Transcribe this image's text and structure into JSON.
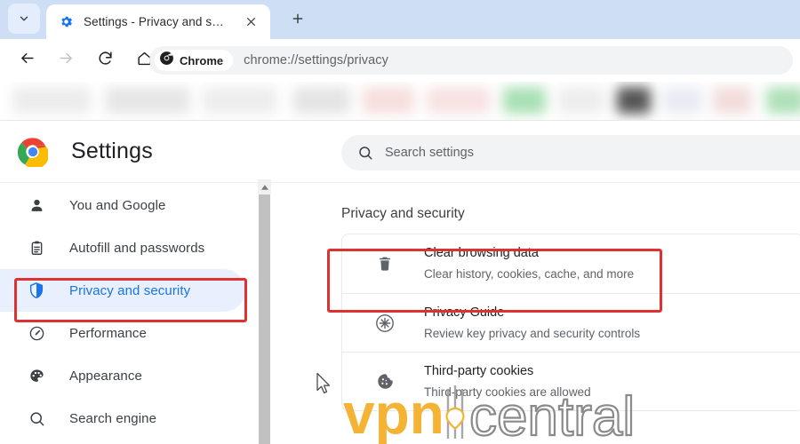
{
  "window": {
    "tab": {
      "title": "Settings - Privacy and security",
      "favicon_icon": "gear-icon",
      "close_icon": "close-icon"
    },
    "tab_search_icon": "chevron-down-icon",
    "new_tab_icon": "plus-icon",
    "toolbar": {
      "back_icon": "arrow-left-icon",
      "forward_icon": "arrow-right-icon",
      "reload_icon": "reload-icon",
      "home_icon": "home-icon",
      "chip_label": "Chrome",
      "chip_icon": "chrome-circle-icon",
      "url": "chrome://settings/privacy"
    }
  },
  "settings_header": {
    "logo_icon": "chrome-logo-icon",
    "title": "Settings",
    "search": {
      "icon": "search-icon",
      "placeholder": "Search settings",
      "value": ""
    }
  },
  "sidebar": {
    "items": [
      {
        "label": "You and Google",
        "icon": "person-icon",
        "selected": false
      },
      {
        "label": "Autofill and passwords",
        "icon": "clipboard-icon",
        "selected": false
      },
      {
        "label": "Privacy and security",
        "icon": "shield-icon",
        "selected": true
      },
      {
        "label": "Performance",
        "icon": "speedometer-icon",
        "selected": false
      },
      {
        "label": "Appearance",
        "icon": "palette-icon",
        "selected": false
      },
      {
        "label": "Search engine",
        "icon": "search-icon",
        "selected": false
      }
    ],
    "scrollbar": {
      "up_arrow_icon": "scroll-up-arrow-icon"
    }
  },
  "main": {
    "section_title": "Privacy and security",
    "rows": [
      {
        "icon": "trash-icon",
        "title": "Clear browsing data",
        "subtitle": "Clear history, cookies, cache, and more"
      },
      {
        "icon": "privacy-guide-icon",
        "title": "Privacy Guide",
        "subtitle": "Review key privacy and security controls"
      },
      {
        "icon": "cookie-icon",
        "title": "Third-party cookies",
        "subtitle": "Third-party cookies are allowed"
      }
    ]
  },
  "annotations": {
    "highlight_color": "#e03131",
    "boxes": [
      {
        "name": "privacy-and-security-sidebar-highlight"
      },
      {
        "name": "clear-browsing-data-highlight"
      }
    ]
  },
  "watermark": {
    "text_primary": "vpn",
    "text_secondary": "central",
    "color_primary": "#f5b335",
    "color_secondary": "#8a8a8a"
  },
  "colors": {
    "tabstrip_bg": "#cddef5",
    "accent_blue": "#1a73e8",
    "selected_row_bg": "#e8f0fe",
    "omnibox_bg": "#f1f3f4"
  }
}
